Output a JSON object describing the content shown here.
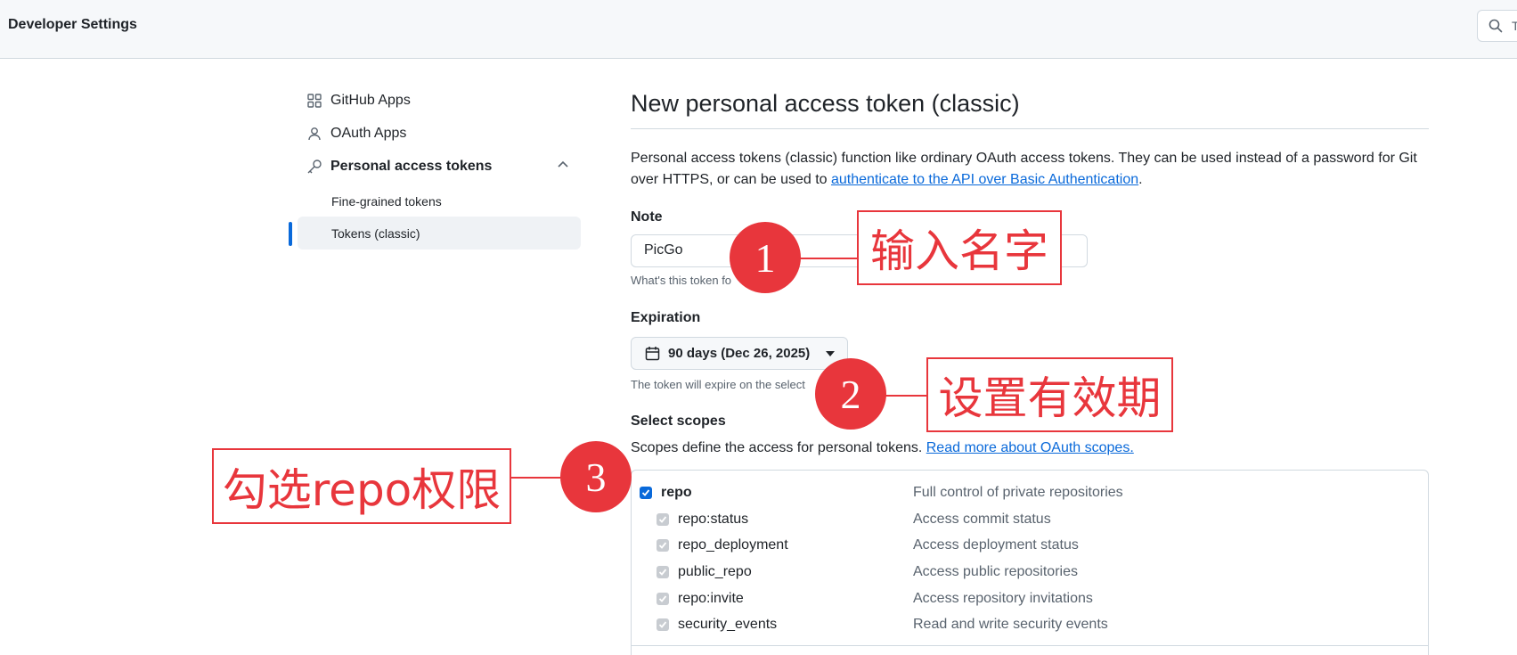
{
  "header": {
    "title": "Developer Settings",
    "search_placeholder": "T"
  },
  "sidebar": {
    "items": [
      {
        "label": "GitHub Apps",
        "icon": "apps-grid-icon"
      },
      {
        "label": "OAuth Apps",
        "icon": "person-icon"
      },
      {
        "label": "Personal access tokens",
        "icon": "key-icon"
      }
    ],
    "subitems": [
      {
        "label": "Fine-grained tokens"
      },
      {
        "label": "Tokens (classic)",
        "active": true
      }
    ]
  },
  "main": {
    "title": "New personal access token (classic)",
    "intro_text": "Personal access tokens (classic) function like ordinary OAuth access tokens. They can be used instead of a password for Git over HTTPS, or can be used to ",
    "intro_link": "authenticate to the API over Basic Authentication",
    "intro_end": ".",
    "note": {
      "label": "Note",
      "value": "PicGo",
      "hint": "What's this token fo"
    },
    "expiration": {
      "label": "Expiration",
      "value": "90 days (Dec 26, 2025)",
      "hint": "The token will expire on the select"
    },
    "scopes": {
      "label": "Select scopes",
      "intro_text": "Scopes define the access for personal tokens. ",
      "intro_link": "Read more about OAuth scopes.",
      "items": [
        {
          "name": "repo",
          "desc": "Full control of private repositories",
          "checked": true,
          "parent": true
        },
        {
          "name": "repo:status",
          "desc": "Access commit status",
          "checked": true
        },
        {
          "name": "repo_deployment",
          "desc": "Access deployment status",
          "checked": true
        },
        {
          "name": "public_repo",
          "desc": "Access public repositories",
          "checked": true
        },
        {
          "name": "repo:invite",
          "desc": "Access repository invitations",
          "checked": true
        },
        {
          "name": "security_events",
          "desc": "Read and write security events",
          "checked": true
        }
      ]
    }
  },
  "annotations": [
    {
      "number": "1",
      "text": "输入名字"
    },
    {
      "number": "2",
      "text": "设置有效期"
    },
    {
      "number": "3",
      "text": "勾选repo权限"
    }
  ],
  "colors": {
    "accent": "#0969da",
    "annotation": "#e8363c"
  }
}
